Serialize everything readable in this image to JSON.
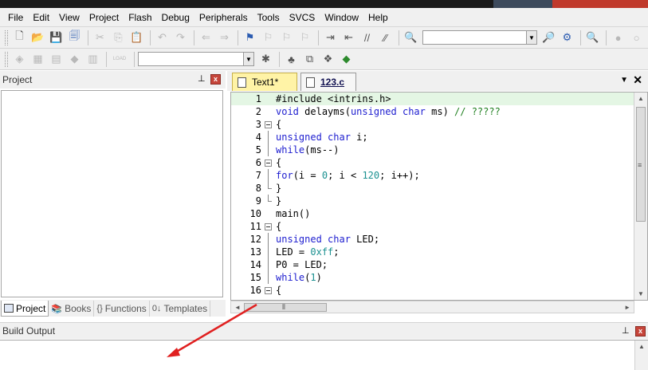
{
  "menubar": {
    "items": [
      "File",
      "Edit",
      "View",
      "Project",
      "Flash",
      "Debug",
      "Peripherals",
      "Tools",
      "SVCS",
      "Window",
      "Help"
    ]
  },
  "toolbar1": {
    "combo_value": ""
  },
  "toolbar2": {
    "target_combo_value": "",
    "load_label": "LOAD"
  },
  "project_panel": {
    "title": "Project",
    "pin": "📌",
    "close": "x",
    "tabs": [
      {
        "label": "Project",
        "icon": "project-icon"
      },
      {
        "label": "Books",
        "icon": "books-icon"
      },
      {
        "label": "Functions",
        "icon": "functions-icon"
      },
      {
        "label": "Templates",
        "icon": "templates-icon"
      }
    ],
    "tab_icons": {
      "functions": "{}",
      "templates": "0↓"
    }
  },
  "editor": {
    "tabs": [
      {
        "label": "Text1*",
        "active": false
      },
      {
        "label": "123.c",
        "active": true
      }
    ],
    "menu_glyph": "▼",
    "close_glyph": "✕",
    "lines": [
      {
        "n": "1",
        "text": "#include <intrins.h>"
      },
      {
        "n": "2",
        "text": "void delayms(unsigned char ms) // ?????"
      },
      {
        "n": "3",
        "text": "{"
      },
      {
        "n": "4",
        "text": "unsigned char i;"
      },
      {
        "n": "5",
        "text": "while(ms--)"
      },
      {
        "n": "6",
        "text": "{"
      },
      {
        "n": "7",
        "text": "for(i = 0; i < 120; i++);"
      },
      {
        "n": "8",
        "text": "}"
      },
      {
        "n": "9",
        "text": "}"
      },
      {
        "n": "10",
        "text": "main()"
      },
      {
        "n": "11",
        "text": "{"
      },
      {
        "n": "12",
        "text": "unsigned char LED;"
      },
      {
        "n": "13",
        "text": "LED = 0xff;"
      },
      {
        "n": "14",
        "text": "P0 = LED;"
      },
      {
        "n": "15",
        "text": "while(1)"
      },
      {
        "n": "16",
        "text": "{"
      }
    ]
  },
  "build_output": {
    "title": "Build Output",
    "pin": "📌",
    "close": "x"
  },
  "colors": {
    "keyword": "#2020d0",
    "number": "#1a9090",
    "comment": "#208020",
    "annotation_arrow": "#e02020",
    "tab_active_bg": "#fff3a6"
  }
}
